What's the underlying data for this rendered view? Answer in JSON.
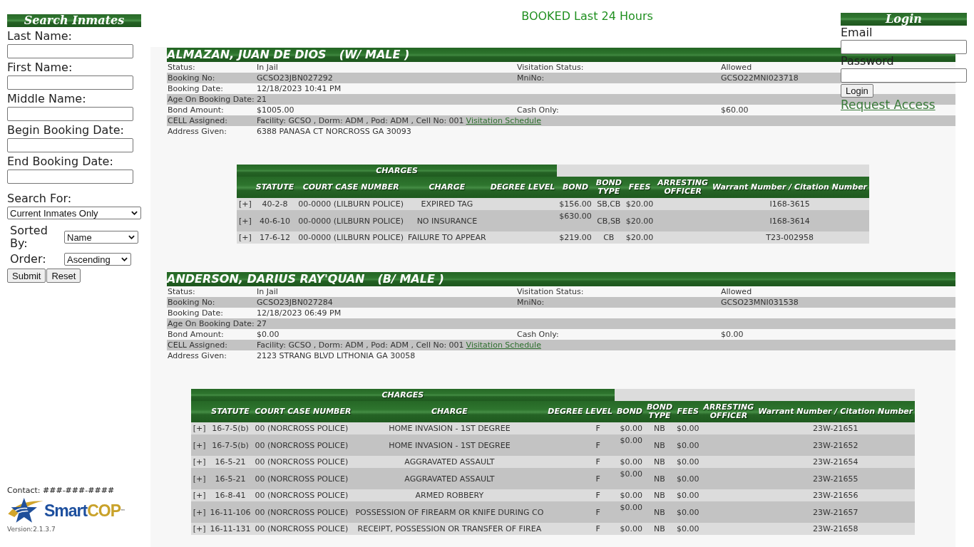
{
  "sidebar": {
    "title": "Search Inmates",
    "fields": [
      {
        "label": "Last Name:"
      },
      {
        "label": "First Name:"
      },
      {
        "label": "Middle Name:"
      },
      {
        "label": "Begin Booking Date:"
      },
      {
        "label": "End Booking Date:"
      }
    ],
    "search_for": {
      "label": "Search For:",
      "value": "Current Inmates Only"
    },
    "sorted_by": {
      "label": "Sorted By:",
      "value": "Name"
    },
    "order": {
      "label": "Order:",
      "value": "Ascending"
    },
    "buttons": [
      "Submit",
      "Reset"
    ],
    "contact": "Contact: ###-###-####",
    "logo": {
      "words": [
        "Smart",
        "COP"
      ],
      "mark": "™"
    },
    "version": "Version:2.1.3.7"
  },
  "heading": "BOOKED Last 24 Hours",
  "login": {
    "title": "Login",
    "fields": [
      {
        "label": "Email"
      },
      {
        "label": "Password"
      }
    ],
    "button": "Login",
    "link": "Request Access"
  },
  "inmates": [
    {
      "name": "ALMAZAN, JUAN DE DIOS",
      "race_sex": "(W/ MALE )",
      "details": [
        {
          "label": "Status:",
          "value": "In Jail",
          "label_2": "Visitation Status:",
          "value_2": "Allowed"
        },
        {
          "label": "Booking No:",
          "value": "GCSO23JBN027292",
          "label_2": "MniNo:",
          "value_2": "GCSO22MNI023718"
        },
        {
          "label": "Booking Date:",
          "value": "12/18/2023 10:41 PM"
        },
        {
          "label": "Age On Booking Date:",
          "value": "21"
        },
        {
          "label": "Bond Amount:",
          "value": "$1005.00",
          "label_2": "Cash Only:",
          "value_2": "$60.00"
        },
        {
          "label": "CELL Assigned:",
          "value": "Facility: GCSO , Dorm: ADM , Pod: ADM , Cell No: 001",
          "link": "Visitation Schedule"
        },
        {
          "label": "Address Given:",
          "value": "6388 PANASA CT NORCROSS GA 30093"
        }
      ],
      "charges": {
        "title": "CHARGES",
        "columns": [
          "STATUTE",
          "COURT CASE NUMBER",
          "CHARGE",
          "DEGREE LEVEL",
          "BOND",
          "BOND TYPE",
          "FEES",
          "ARRESTING OFFICER",
          "Warrant Number / Citation Number"
        ],
        "rows": [
          {
            "toggle": "[+]",
            "statute": "40-2-8",
            "court_case_number": "00-0000 (LILBURN POLICE)",
            "charge": "EXPIRED TAG",
            "bond": "$156.00",
            "bond_type": "SB,CB",
            "fees": "$20.00",
            "warrant_number": "I168-3615"
          },
          {
            "toggle": "[+]",
            "statute": "40-6-10",
            "court_case_number": "00-0000 (LILBURN POLICE)",
            "charge": "NO INSURANCE",
            "bond": "$630.00",
            "bond_type": "CB,SB",
            "fees": "$20.00",
            "warrant_number": "I168-3614"
          },
          {
            "toggle": "[+]",
            "statute": "17-6-12",
            "court_case_number": "00-0000 (LILBURN POLICE)",
            "charge": "FAILURE TO APPEAR",
            "bond": "$219.00",
            "bond_type": "CB",
            "fees": "$20.00",
            "warrant_number": "T23-002958"
          }
        ]
      }
    },
    {
      "name": "ANDERSON, DARIUS RAY'QUAN",
      "race_sex": "(B/ MALE )",
      "details": [
        {
          "label": "Status:",
          "value": "In Jail",
          "label_2": "Visitation Status:",
          "value_2": "Allowed"
        },
        {
          "label": "Booking No:",
          "value": "GCSO23JBN027284",
          "label_2": "MniNo:",
          "value_2": "GCSO23MNI031538"
        },
        {
          "label": "Booking Date:",
          "value": "12/18/2023 06:49 PM"
        },
        {
          "label": "Age On Booking Date:",
          "value": "27"
        },
        {
          "label": "Bond Amount:",
          "value": "$0.00",
          "label_2": "Cash Only:",
          "value_2": "$0.00"
        },
        {
          "label": "CELL Assigned:",
          "value": "Facility: GCSO , Dorm: ADM , Pod: ADM , Cell No: 001",
          "link": "Visitation Schedule"
        },
        {
          "label": "Address Given:",
          "value": "2123 STRANG BLVD LITHONIA GA 30058"
        }
      ],
      "charges": {
        "title": "CHARGES",
        "columns": [
          "STATUTE",
          "COURT CASE NUMBER",
          "CHARGE",
          "DEGREE LEVEL",
          "BOND",
          "BOND TYPE",
          "FEES",
          "ARRESTING OFFICER",
          "Warrant Number / Citation Number"
        ],
        "rows": [
          {
            "toggle": "[+]",
            "statute": "16-7-5(b)",
            "court_case_number": "00 (NORCROSS POLICE)",
            "charge": "HOME INVASION - 1ST DEGREE",
            "degree_level": "F",
            "bond": "$0.00",
            "bond_type": "NB",
            "fees": "$0.00",
            "warrant_number": "23W-21651"
          },
          {
            "toggle": "[+]",
            "statute": "16-7-5(b)",
            "court_case_number": "00 (NORCROSS POLICE)",
            "charge": "HOME INVASION - 1ST DEGREE",
            "degree_level": "F",
            "bond": "$0.00",
            "bond_type": "NB",
            "fees": "$0.00",
            "warrant_number": "23W-21652"
          },
          {
            "toggle": "[+]",
            "statute": "16-5-21",
            "court_case_number": "00 (NORCROSS POLICE)",
            "charge": "AGGRAVATED ASSAULT",
            "degree_level": "F",
            "bond": "$0.00",
            "bond_type": "NB",
            "fees": "$0.00",
            "warrant_number": "23W-21654"
          },
          {
            "toggle": "[+]",
            "statute": "16-5-21",
            "court_case_number": "00 (NORCROSS POLICE)",
            "charge": "AGGRAVATED ASSAULT",
            "degree_level": "F",
            "bond": "$0.00",
            "bond_type": "NB",
            "fees": "$0.00",
            "warrant_number": "23W-21655"
          },
          {
            "toggle": "[+]",
            "statute": "16-8-41",
            "court_case_number": "00 (NORCROSS POLICE)",
            "charge": "ARMED ROBBERY",
            "degree_level": "F",
            "bond": "$0.00",
            "bond_type": "NB",
            "fees": "$0.00",
            "warrant_number": "23W-21656"
          },
          {
            "toggle": "[+]",
            "statute": "16-11-106",
            "court_case_number": "00 (NORCROSS POLICE)",
            "charge": "POSSESSION OF FIREARM OR KNIFE DURING CO",
            "degree_level": "F",
            "bond": "$0.00",
            "bond_type": "NB",
            "fees": "$0.00",
            "warrant_number": "23W-21657"
          },
          {
            "toggle": "[+]",
            "statute": "16-11-131",
            "court_case_number": "00 (NORCROSS POLICE)",
            "charge": "RECEIPT, POSSESSION OR TRANSFER OF FIREA",
            "degree_level": "F",
            "bond": "$0.00",
            "bond_type": "NB",
            "fees": "$0.00",
            "warrant_number": "23W-21658"
          }
        ]
      }
    }
  ]
}
